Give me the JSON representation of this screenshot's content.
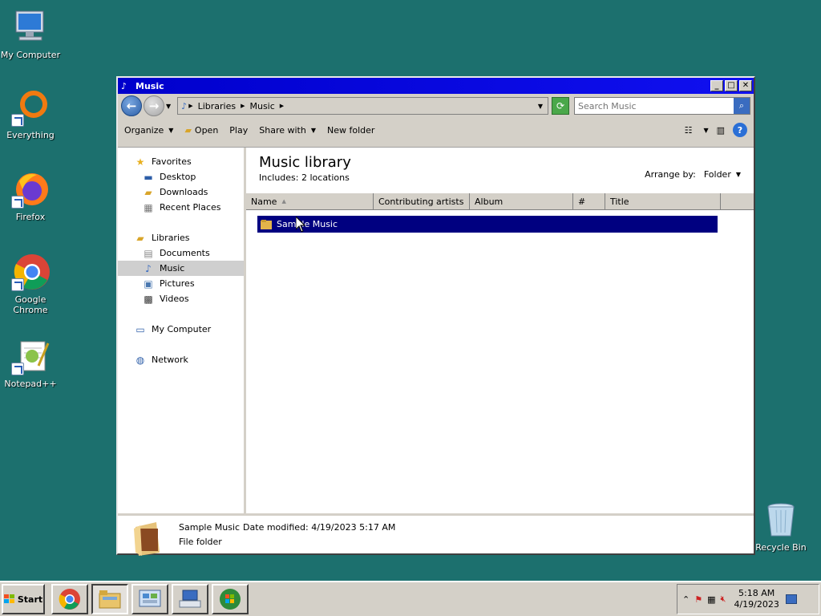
{
  "desktop": {
    "icons": [
      {
        "label": "My Computer",
        "icon": "computer-icon"
      },
      {
        "label": "Everything",
        "icon": "everything-icon"
      },
      {
        "label": "Firefox",
        "icon": "firefox-icon"
      },
      {
        "label": "Google Chrome",
        "icon": "chrome-icon"
      },
      {
        "label": "Notepad++",
        "icon": "notepadpp-icon"
      }
    ],
    "recycle_bin": {
      "label": "Recycle Bin",
      "icon": "recycle-bin-icon"
    }
  },
  "window": {
    "title": "Music",
    "address": {
      "crumbs": [
        "Libraries",
        "Music"
      ]
    },
    "search": {
      "placeholder": "Search Music"
    },
    "toolbar": {
      "organize": "Organize",
      "open": "Open",
      "play": "Play",
      "share_with": "Share with",
      "new_folder": "New folder"
    },
    "nav": {
      "favorites": "Favorites",
      "desktop": "Desktop",
      "downloads": "Downloads",
      "recent_places": "Recent Places",
      "libraries": "Libraries",
      "documents": "Documents",
      "music": "Music",
      "pictures": "Pictures",
      "videos": "Videos",
      "my_computer": "My Computer",
      "network": "Network"
    },
    "library": {
      "title": "Music library",
      "includes_label": "Includes:",
      "includes_value": "2 locations",
      "arrange_by_label": "Arrange by:",
      "arrange_by_value": "Folder"
    },
    "columns": [
      "Name",
      "Contributing artists",
      "Album",
      "#",
      "Title"
    ],
    "files": [
      {
        "name": "Sample Music",
        "selected": true
      }
    ],
    "details": {
      "name": "Sample Music",
      "modified_label": "Date modified:",
      "modified_value": "4/19/2023 5:17 AM",
      "type": "File folder"
    }
  },
  "taskbar": {
    "start_label": "Start",
    "apps": [
      "chrome-icon",
      "explorer-icon",
      "control-panel-icon",
      "keyboard-icon",
      "media-player-icon"
    ],
    "clock_time": "5:18 AM",
    "clock_date": "4/19/2023"
  },
  "colors": {
    "desktop_bg": "#1c706e",
    "titlebar": "#0000cc",
    "selection": "#000080"
  }
}
